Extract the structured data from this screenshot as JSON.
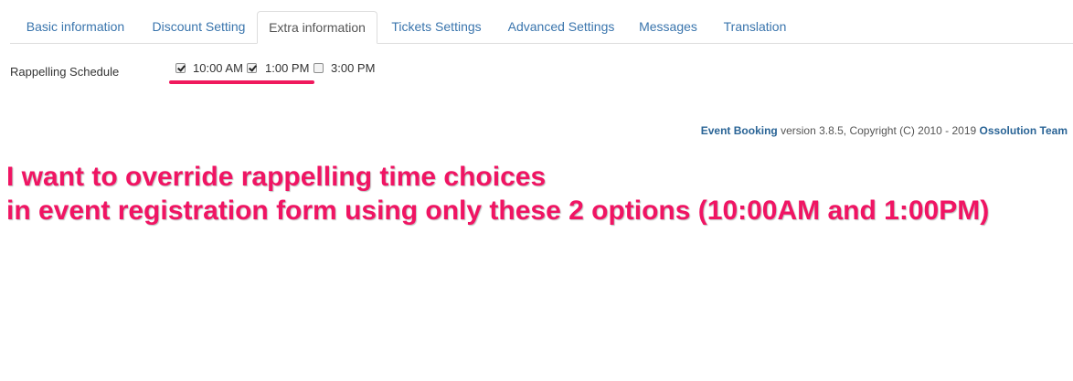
{
  "tabs": [
    {
      "label": "Basic information",
      "active": false
    },
    {
      "label": "Discount Setting",
      "active": false
    },
    {
      "label": "Extra information",
      "active": true
    },
    {
      "label": "Tickets Settings",
      "active": false
    },
    {
      "label": "Advanced Settings",
      "active": false
    },
    {
      "label": "Messages",
      "active": false
    },
    {
      "label": "Translation",
      "active": false
    }
  ],
  "field": {
    "label": "Rappelling Schedule",
    "options": [
      {
        "label": "10:00 AM",
        "checked": true
      },
      {
        "label": "1:00 PM",
        "checked": true
      },
      {
        "label": "3:00 PM",
        "checked": false
      }
    ]
  },
  "footer": {
    "product": "Event Booking",
    "version_text": " version 3.8.5, Copyright (C) 2010 - 2019 ",
    "company": "Ossolution Team"
  },
  "annotation": {
    "line1": "I want to override rappelling time choices",
    "line2": "in event registration form using only these 2 options (10:00AM and 1:00PM)"
  },
  "colors": {
    "link": "#3a75ad",
    "annotation": "#f01463",
    "underline": "#f0195d"
  }
}
